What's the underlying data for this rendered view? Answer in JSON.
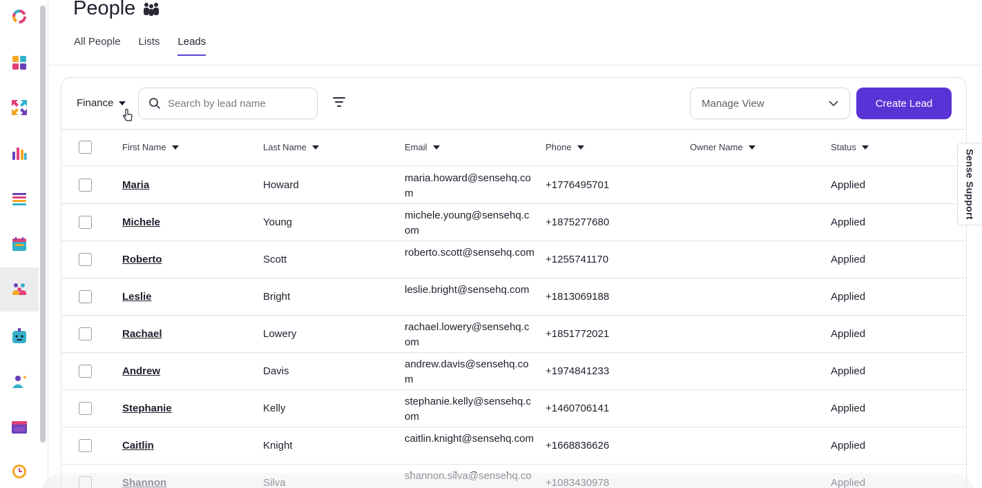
{
  "header": {
    "title": "People",
    "tabs": [
      {
        "label": "All People"
      },
      {
        "label": "Lists"
      },
      {
        "label": "Leads"
      }
    ]
  },
  "toolbar": {
    "group_label": "Finance",
    "search_placeholder": "Search by lead name",
    "manage_view_label": "Manage View",
    "create_label": "Create Lead"
  },
  "table": {
    "columns": [
      "First Name",
      "Last Name",
      "Email",
      "Phone",
      "Owner Name",
      "Status"
    ],
    "rows": [
      {
        "first": "Maria",
        "last": "Howard",
        "email": "maria.howard@sensehq.com",
        "phone": "+1776495701",
        "owner": "",
        "status": "Applied"
      },
      {
        "first": "Michele",
        "last": "Young",
        "email": "michele.young@sensehq.com",
        "phone": "+1875277680",
        "owner": "",
        "status": "Applied"
      },
      {
        "first": "Roberto",
        "last": "Scott",
        "email": "roberto.scott@sensehq.com",
        "phone": "+1255741170",
        "owner": "",
        "status": "Applied"
      },
      {
        "first": "Leslie",
        "last": "Bright",
        "email": "leslie.bright@sensehq.com",
        "phone": "+1813069188",
        "owner": "",
        "status": "Applied"
      },
      {
        "first": "Rachael",
        "last": "Lowery",
        "email": "rachael.lowery@sensehq.com",
        "phone": "+1851772021",
        "owner": "",
        "status": "Applied"
      },
      {
        "first": "Andrew",
        "last": "Davis",
        "email": "andrew.davis@sensehq.com",
        "phone": "+1974841233",
        "owner": "",
        "status": "Applied"
      },
      {
        "first": "Stephanie",
        "last": "Kelly",
        "email": "stephanie.kelly@sensehq.com",
        "phone": "+1460706141",
        "owner": "",
        "status": "Applied"
      },
      {
        "first": "Caitlin",
        "last": "Knight",
        "email": "caitlin.knight@sensehq.com",
        "phone": "+1668836626",
        "owner": "",
        "status": "Applied"
      },
      {
        "first": "Shannon",
        "last": "Silva",
        "email": "shannon.silva@sensehq.com",
        "phone": "+1083430978",
        "owner": "",
        "status": "Applied"
      }
    ]
  },
  "support": {
    "label": "Sense Support"
  },
  "colors": {
    "accent": "#5a33d6",
    "tab_underline": "#5a3fd1"
  },
  "sidebar": {
    "icons": [
      "sense-logo-icon",
      "dashboard-icon",
      "integrations-icon",
      "analytics-icon",
      "lists-icon",
      "calendar-icon",
      "people-icon",
      "chatbot-icon",
      "user-icon",
      "window-icon",
      "timer-icon"
    ]
  }
}
